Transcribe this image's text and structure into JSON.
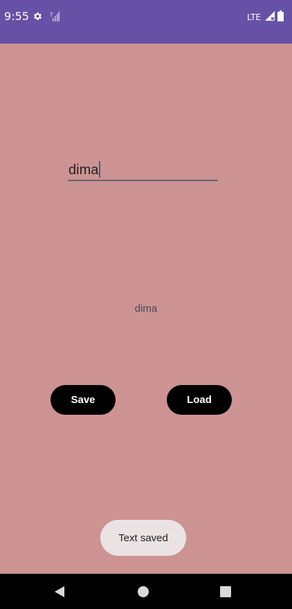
{
  "status_bar": {
    "time": "9:55",
    "network": "LTE",
    "icons": [
      "settings-icon",
      "no-signal-icon",
      "signal-icon",
      "battery-icon"
    ],
    "background": "#6651a6"
  },
  "main": {
    "background": "#cd9393",
    "input": {
      "value": "dima"
    },
    "output_text": "dima",
    "buttons": {
      "save_label": "Save",
      "load_label": "Load"
    }
  },
  "toast": {
    "message": "Text saved"
  },
  "nav_bar": {
    "icons": [
      "back-icon",
      "home-icon",
      "recents-icon"
    ]
  }
}
